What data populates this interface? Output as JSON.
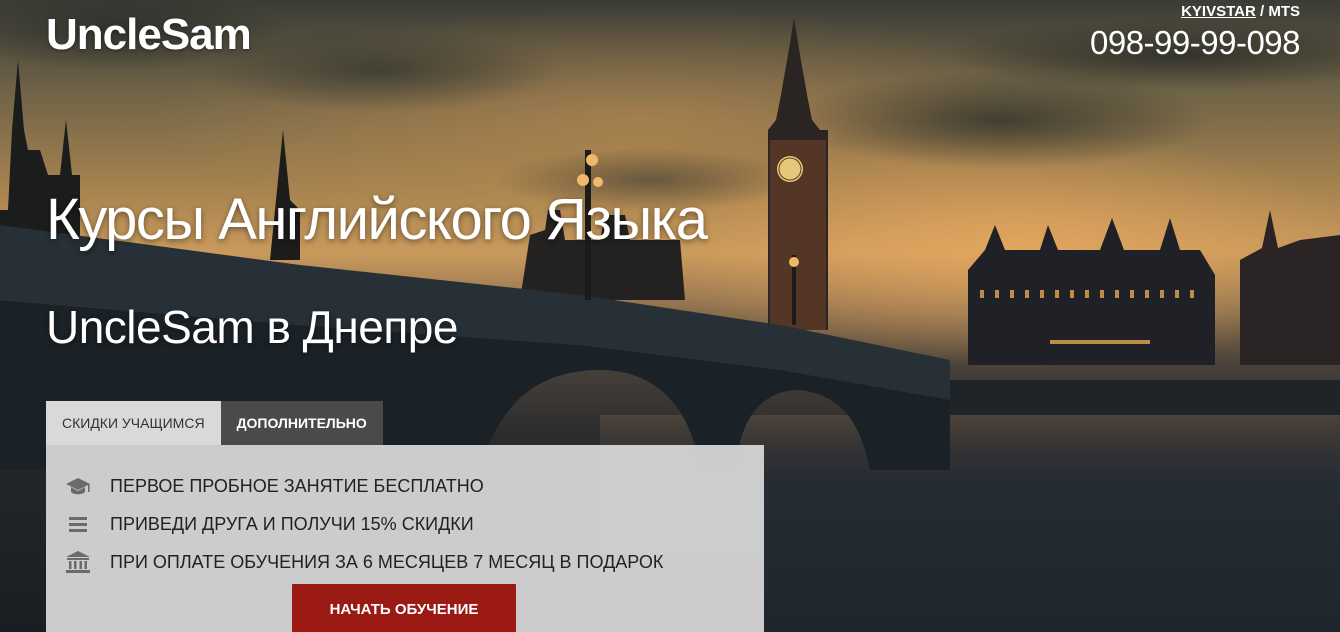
{
  "brand": {
    "logo_text": "UncleSam"
  },
  "contact": {
    "operator_primary": "KYIVSTAR",
    "operator_separator": " / ",
    "operator_secondary": "MTS",
    "phone": "098-99-99-098"
  },
  "hero": {
    "title": "Курсы Английского Языка",
    "subtitle": "UncleSam в Днепре"
  },
  "tabs": [
    {
      "label": "СКИДКИ УЧАЩИМСЯ",
      "active": true
    },
    {
      "label": "ДОПОЛНИТЕЛЬНО",
      "active": false
    }
  ],
  "perks": [
    {
      "icon": "graduation-cap-icon",
      "text": "ПЕРВОЕ ПРОБНОЕ ЗАНЯТИЕ БЕСПЛАТНО"
    },
    {
      "icon": "list-icon",
      "text": "ПРИВЕДИ ДРУГА И ПОЛУЧИ 15% СКИДКИ"
    },
    {
      "icon": "bank-icon",
      "text": "ПРИ ОПЛАТЕ ОБУЧЕНИЯ ЗА 6 МЕСЯЦЕВ 7 МЕСЯЦ В ПОДАРОК"
    }
  ],
  "cta": {
    "label": "НАЧАТЬ ОБУЧЕНИЕ"
  },
  "colors": {
    "cta_background": "#9b1a14",
    "tab_active": "#d9d9d9",
    "tab_inactive": "#4a4a4a",
    "panel_background": "#d9d9d9"
  }
}
